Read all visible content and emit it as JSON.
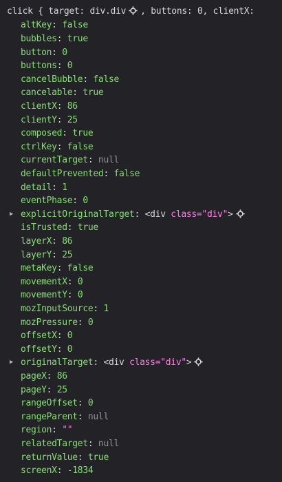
{
  "header": {
    "twisty": "▾",
    "event_name": "click",
    "open_brace": "{",
    "target_key": "target:",
    "target_value": "div.div",
    "comma": ",",
    "buttons_key": "buttons:",
    "buttons_value": "0,",
    "clientx_key": "clientX:"
  },
  "properties": [
    {
      "key": "altKey",
      "value": "false",
      "type": "bool"
    },
    {
      "key": "bubbles",
      "value": "true",
      "type": "bool"
    },
    {
      "key": "button",
      "value": "0",
      "type": "num"
    },
    {
      "key": "buttons",
      "value": "0",
      "type": "num"
    },
    {
      "key": "cancelBubble",
      "value": "false",
      "type": "bool"
    },
    {
      "key": "cancelable",
      "value": "true",
      "type": "bool"
    },
    {
      "key": "clientX",
      "value": "86",
      "type": "num"
    },
    {
      "key": "clientY",
      "value": "25",
      "type": "num"
    },
    {
      "key": "composed",
      "value": "true",
      "type": "bool"
    },
    {
      "key": "ctrlKey",
      "value": "false",
      "type": "bool"
    },
    {
      "key": "currentTarget",
      "value": "null",
      "type": "null"
    },
    {
      "key": "defaultPrevented",
      "value": "false",
      "type": "bool"
    },
    {
      "key": "detail",
      "value": "1",
      "type": "num"
    },
    {
      "key": "eventPhase",
      "value": "0",
      "type": "num"
    },
    {
      "key": "explicitOriginalTarget",
      "type": "node",
      "tag_open": "<div",
      "attr_name": "class=",
      "attr_value": "\"div\"",
      "tag_close": ">"
    },
    {
      "key": "isTrusted",
      "value": "true",
      "type": "bool"
    },
    {
      "key": "layerX",
      "value": "86",
      "type": "num"
    },
    {
      "key": "layerY",
      "value": "25",
      "type": "num"
    },
    {
      "key": "metaKey",
      "value": "false",
      "type": "bool"
    },
    {
      "key": "movementX",
      "value": "0",
      "type": "num"
    },
    {
      "key": "movementY",
      "value": "0",
      "type": "num"
    },
    {
      "key": "mozInputSource",
      "value": "1",
      "type": "num"
    },
    {
      "key": "mozPressure",
      "value": "0",
      "type": "num"
    },
    {
      "key": "offsetX",
      "value": "0",
      "type": "num"
    },
    {
      "key": "offsetY",
      "value": "0",
      "type": "num"
    },
    {
      "key": "originalTarget",
      "type": "node",
      "tag_open": "<div",
      "attr_name": "class=",
      "attr_value": "\"div\"",
      "tag_close": ">"
    },
    {
      "key": "pageX",
      "value": "86",
      "type": "num"
    },
    {
      "key": "pageY",
      "value": "25",
      "type": "num"
    },
    {
      "key": "rangeOffset",
      "value": "0",
      "type": "num"
    },
    {
      "key": "rangeParent",
      "value": "null",
      "type": "null"
    },
    {
      "key": "region",
      "value": "\"\"",
      "type": "str"
    },
    {
      "key": "relatedTarget",
      "value": "null",
      "type": "null"
    },
    {
      "key": "returnValue",
      "value": "true",
      "type": "bool"
    },
    {
      "key": "screenX",
      "value": "-1834",
      "type": "num"
    }
  ],
  "colors": {
    "background": "#232327",
    "key": "#86de74",
    "null": "#939395",
    "string": "#ff7de9",
    "text": "#d7d7db"
  },
  "icons": {
    "twisty_collapsed": "triangle-right-icon",
    "twisty_expanded": "triangle-down-icon",
    "inspect": "inspect-node-icon"
  }
}
